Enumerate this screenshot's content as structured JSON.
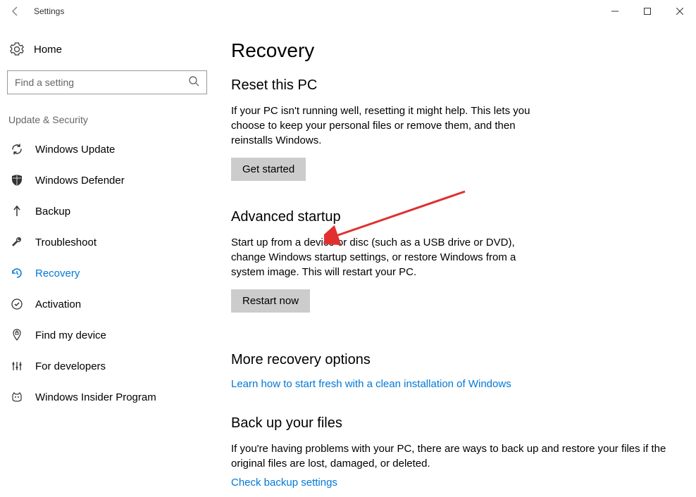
{
  "titlebar": {
    "title": "Settings"
  },
  "sidebar": {
    "home": "Home",
    "search_placeholder": "Find a setting",
    "section": "Update & Security",
    "items": [
      {
        "id": "windows-update",
        "label": "Windows Update"
      },
      {
        "id": "windows-defender",
        "label": "Windows Defender"
      },
      {
        "id": "backup",
        "label": "Backup"
      },
      {
        "id": "troubleshoot",
        "label": "Troubleshoot"
      },
      {
        "id": "recovery",
        "label": "Recovery"
      },
      {
        "id": "activation",
        "label": "Activation"
      },
      {
        "id": "find-my-device",
        "label": "Find my device"
      },
      {
        "id": "for-developers",
        "label": "For developers"
      },
      {
        "id": "windows-insider",
        "label": "Windows Insider Program"
      }
    ]
  },
  "main": {
    "title": "Recovery",
    "reset": {
      "heading": "Reset this PC",
      "desc": "If your PC isn't running well, resetting it might help. This lets you choose to keep your personal files or remove them, and then reinstalls Windows.",
      "button": "Get started"
    },
    "advanced": {
      "heading": "Advanced startup",
      "desc": "Start up from a device or disc (such as a USB drive or DVD), change Windows startup settings, or restore Windows from a system image. This will restart your PC.",
      "button": "Restart now"
    },
    "more": {
      "heading": "More recovery options",
      "link": "Learn how to start fresh with a clean installation of Windows"
    },
    "backup": {
      "heading": "Back up your files",
      "desc": "If you're having problems with your PC, there are ways to back up and restore your files if the original files are lost, damaged, or deleted.",
      "link": "Check backup settings"
    }
  }
}
